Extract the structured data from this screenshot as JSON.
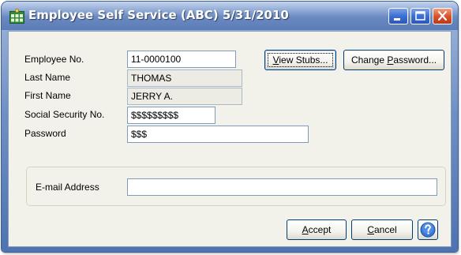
{
  "window": {
    "title": "Employee Self Service (ABC) 5/31/2010"
  },
  "form": {
    "employee_no": {
      "label": "Employee No.",
      "value": "11-0000100"
    },
    "last_name": {
      "label": "Last Name",
      "value": "THOMAS"
    },
    "first_name": {
      "label": "First Name",
      "value": "JERRY A."
    },
    "ssn": {
      "label": "Social Security No.",
      "value": "$$$$$$$$$"
    },
    "password": {
      "label": "Password",
      "value": "$$$"
    },
    "email": {
      "label": "E-mail Address",
      "value": ""
    }
  },
  "buttons": {
    "view_stubs": {
      "pre": "",
      "key": "V",
      "post": "iew Stubs..."
    },
    "change_password": {
      "pre": "Change ",
      "key": "P",
      "post": "assword..."
    },
    "accept": {
      "pre": "",
      "key": "A",
      "post": "ccept"
    },
    "cancel": {
      "pre": "",
      "key": "C",
      "post": "ancel"
    }
  },
  "colors": {
    "titlebar": "#5b7cb8",
    "client_bg": "#f3f2ea",
    "readonly_bg": "#ecebe4",
    "close_button": "#d9542b",
    "help_icon": "#3a78d6"
  },
  "icons": {
    "app": "employee-grid-icon",
    "minimize": "minimize-icon",
    "maximize": "maximize-icon",
    "close": "close-icon",
    "help": "question-mark-icon"
  }
}
